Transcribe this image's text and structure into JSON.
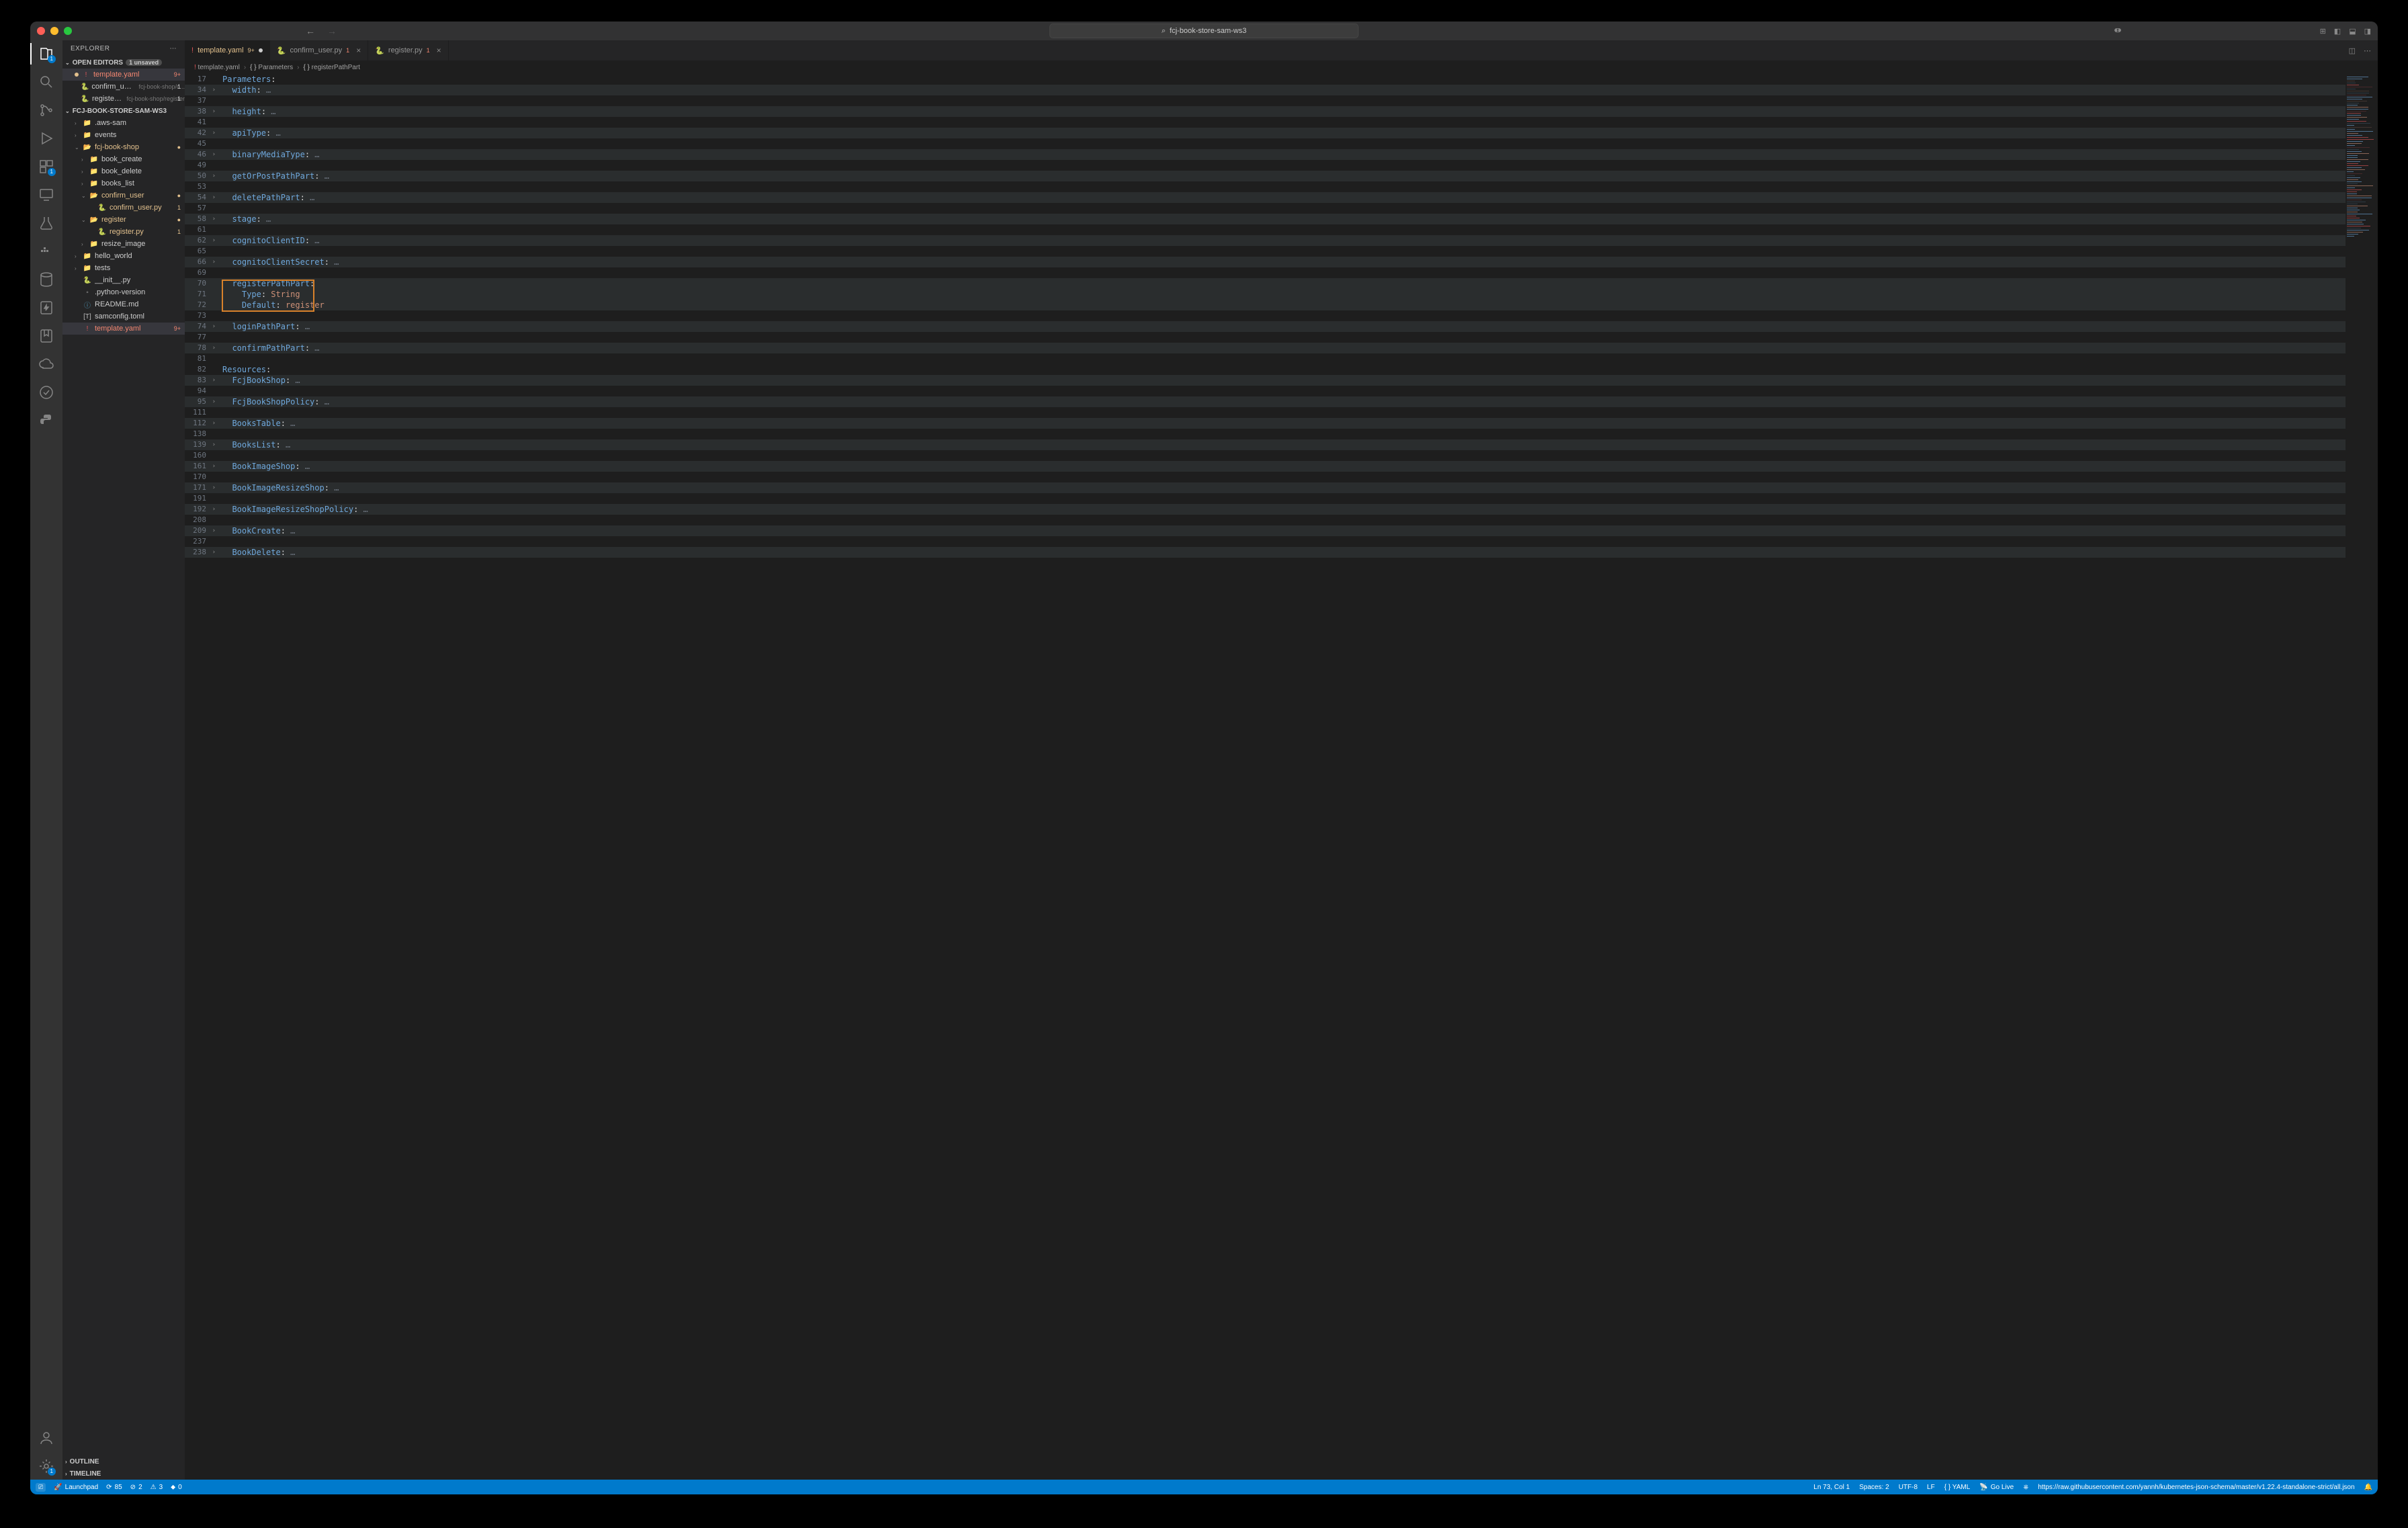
{
  "title": {
    "search_text": "fcj-book-store-sam-ws3"
  },
  "activity": {
    "badges": {
      "explorer": "1",
      "extensions": "1"
    }
  },
  "sidebar": {
    "title": "EXPLORER",
    "open_editors": {
      "label": "OPEN EDITORS",
      "unsaved_badge": "1 unsaved",
      "items": [
        {
          "name": "template.yaml",
          "icon": "yaml",
          "right": "9+",
          "state": "error",
          "active": true,
          "modified": true
        },
        {
          "name": "confirm_user.py",
          "desc": "fcj-book-shop/c...",
          "icon": "py",
          "right": "1"
        },
        {
          "name": "register.py",
          "desc": "fcj-book-shop/register",
          "icon": "py",
          "right": "1"
        }
      ]
    },
    "workspace": {
      "label": "FCJ-BOOK-STORE-SAM-WS3",
      "tree": [
        {
          "name": ".aws-sam",
          "icon": "folder-c",
          "depth": 0,
          "chev": "›"
        },
        {
          "name": "events",
          "icon": "folder-c",
          "depth": 0,
          "chev": "›"
        },
        {
          "name": "fcj-book-shop",
          "icon": "folder",
          "depth": 0,
          "chev": "⌄",
          "state": "modified",
          "right": "●"
        },
        {
          "name": "book_create",
          "icon": "folder-c",
          "depth": 1,
          "chev": "›"
        },
        {
          "name": "book_delete",
          "icon": "folder-c",
          "depth": 1,
          "chev": "›"
        },
        {
          "name": "books_list",
          "icon": "folder-c",
          "depth": 1,
          "chev": "›"
        },
        {
          "name": "confirm_user",
          "icon": "folder",
          "depth": 1,
          "chev": "⌄",
          "state": "modified",
          "right": "●"
        },
        {
          "name": "confirm_user.py",
          "icon": "py",
          "depth": 2,
          "right": "1",
          "state": "modified"
        },
        {
          "name": "register",
          "icon": "folder",
          "depth": 1,
          "chev": "⌄",
          "state": "modified",
          "right": "●"
        },
        {
          "name": "register.py",
          "icon": "py",
          "depth": 2,
          "right": "1",
          "state": "modified"
        },
        {
          "name": "resize_image",
          "icon": "folder-c",
          "depth": 1,
          "chev": "›"
        },
        {
          "name": "hello_world",
          "icon": "folder-c",
          "depth": 0,
          "chev": "›"
        },
        {
          "name": "tests",
          "icon": "folder-c",
          "depth": 0,
          "chev": "›"
        },
        {
          "name": "__init__.py",
          "icon": "py",
          "depth": 0
        },
        {
          "name": ".python-version",
          "icon": "generic",
          "depth": 0
        },
        {
          "name": "README.md",
          "icon": "md",
          "depth": 0
        },
        {
          "name": "samconfig.toml",
          "icon": "toml",
          "depth": 0
        },
        {
          "name": "template.yaml",
          "icon": "yaml",
          "depth": 0,
          "right": "9+",
          "state": "error",
          "active": true
        }
      ]
    },
    "outline": "OUTLINE",
    "timeline": "TIMELINE"
  },
  "tabs": [
    {
      "name": "template.yaml",
      "icon": "yaml",
      "badge": "9+",
      "modified": true,
      "active": true
    },
    {
      "name": "confirm_user.py",
      "icon": "py",
      "err": "1"
    },
    {
      "name": "register.py",
      "icon": "py",
      "err": "1"
    }
  ],
  "breadcrumb": [
    {
      "icon": "yaml",
      "label": "template.yaml"
    },
    {
      "icon": "brace",
      "label": "Parameters"
    },
    {
      "icon": "brace",
      "label": "registerPathPart"
    }
  ],
  "code_lines": [
    {
      "n": 17,
      "tokens": [
        [
          "key",
          "Parameters"
        ],
        [
          "punc",
          ":"
        ]
      ]
    },
    {
      "n": 34,
      "fold": true,
      "hl": true,
      "tokens": [
        [
          "ind",
          "  "
        ],
        [
          "key",
          "width"
        ],
        [
          "punc",
          ":"
        ],
        [
          "ell",
          " …"
        ]
      ]
    },
    {
      "n": 37
    },
    {
      "n": 38,
      "fold": true,
      "hl": true,
      "tokens": [
        [
          "ind",
          "  "
        ],
        [
          "key",
          "height"
        ],
        [
          "punc",
          ":"
        ],
        [
          "ell",
          " …"
        ]
      ]
    },
    {
      "n": 41
    },
    {
      "n": 42,
      "fold": true,
      "hl": true,
      "tokens": [
        [
          "ind",
          "  "
        ],
        [
          "key",
          "apiType"
        ],
        [
          "punc",
          ":"
        ],
        [
          "ell",
          " …"
        ]
      ]
    },
    {
      "n": 45
    },
    {
      "n": 46,
      "fold": true,
      "hl": true,
      "tokens": [
        [
          "ind",
          "  "
        ],
        [
          "key",
          "binaryMediaType"
        ],
        [
          "punc",
          ":"
        ],
        [
          "ell",
          " …"
        ]
      ]
    },
    {
      "n": 49
    },
    {
      "n": 50,
      "fold": true,
      "hl": true,
      "tokens": [
        [
          "ind",
          "  "
        ],
        [
          "key",
          "getOrPostPathPart"
        ],
        [
          "punc",
          ":"
        ],
        [
          "ell",
          " …"
        ]
      ]
    },
    {
      "n": 53
    },
    {
      "n": 54,
      "fold": true,
      "hl": true,
      "tokens": [
        [
          "ind",
          "  "
        ],
        [
          "key",
          "deletePathPart"
        ],
        [
          "punc",
          ":"
        ],
        [
          "ell",
          " …"
        ]
      ]
    },
    {
      "n": 57
    },
    {
      "n": 58,
      "fold": true,
      "hl": true,
      "tokens": [
        [
          "ind",
          "  "
        ],
        [
          "key",
          "stage"
        ],
        [
          "punc",
          ":"
        ],
        [
          "ell",
          " …"
        ]
      ]
    },
    {
      "n": 61
    },
    {
      "n": 62,
      "fold": true,
      "hl": true,
      "tokens": [
        [
          "ind",
          "  "
        ],
        [
          "key",
          "cognitoClientID"
        ],
        [
          "punc",
          ":"
        ],
        [
          "ell",
          " …"
        ]
      ]
    },
    {
      "n": 65
    },
    {
      "n": 66,
      "fold": true,
      "hl": true,
      "tokens": [
        [
          "ind",
          "  "
        ],
        [
          "key",
          "cognitoClientSecret"
        ],
        [
          "punc",
          ":"
        ],
        [
          "ell",
          " …"
        ]
      ]
    },
    {
      "n": 69
    },
    {
      "n": 70,
      "hl": true,
      "tokens": [
        [
          "ind",
          "  "
        ],
        [
          "key",
          "registerPathPart"
        ],
        [
          "punc",
          ":"
        ]
      ]
    },
    {
      "n": 71,
      "hl": true,
      "tokens": [
        [
          "ind",
          "    "
        ],
        [
          "key",
          "Type"
        ],
        [
          "punc",
          ": "
        ],
        [
          "str",
          "String"
        ]
      ]
    },
    {
      "n": 72,
      "hl": true,
      "tokens": [
        [
          "ind",
          "    "
        ],
        [
          "key",
          "Default"
        ],
        [
          "punc",
          ": "
        ],
        [
          "str",
          "register"
        ]
      ]
    },
    {
      "n": 73,
      "current": true
    },
    {
      "n": 74,
      "fold": true,
      "hl": true,
      "tokens": [
        [
          "ind",
          "  "
        ],
        [
          "key",
          "loginPathPart"
        ],
        [
          "punc",
          ":"
        ],
        [
          "ell",
          " …"
        ]
      ]
    },
    {
      "n": 77
    },
    {
      "n": 78,
      "fold": true,
      "hl": true,
      "tokens": [
        [
          "ind",
          "  "
        ],
        [
          "key",
          "confirmPathPart"
        ],
        [
          "punc",
          ":"
        ],
        [
          "ell",
          " …"
        ]
      ]
    },
    {
      "n": 81
    },
    {
      "n": 82,
      "tokens": [
        [
          "key",
          "Resources"
        ],
        [
          "punc",
          ":"
        ]
      ]
    },
    {
      "n": 83,
      "fold": true,
      "hl": true,
      "tokens": [
        [
          "ind",
          "  "
        ],
        [
          "key",
          "FcjBookShop"
        ],
        [
          "punc",
          ":"
        ],
        [
          "ell",
          " …"
        ]
      ]
    },
    {
      "n": 94
    },
    {
      "n": 95,
      "fold": true,
      "hl": true,
      "tokens": [
        [
          "ind",
          "  "
        ],
        [
          "key",
          "FcjBookShopPolicy"
        ],
        [
          "punc",
          ":"
        ],
        [
          "ell",
          " …"
        ]
      ]
    },
    {
      "n": 111
    },
    {
      "n": 112,
      "fold": true,
      "hl": true,
      "tokens": [
        [
          "ind",
          "  "
        ],
        [
          "key",
          "BooksTable"
        ],
        [
          "punc",
          ":"
        ],
        [
          "ell",
          " …"
        ]
      ]
    },
    {
      "n": 138
    },
    {
      "n": 139,
      "fold": true,
      "hl": true,
      "tokens": [
        [
          "ind",
          "  "
        ],
        [
          "key",
          "BooksList"
        ],
        [
          "punc",
          ":"
        ],
        [
          "ell",
          " …"
        ]
      ]
    },
    {
      "n": 160
    },
    {
      "n": 161,
      "fold": true,
      "hl": true,
      "tokens": [
        [
          "ind",
          "  "
        ],
        [
          "key",
          "BookImageShop"
        ],
        [
          "punc",
          ":"
        ],
        [
          "ell",
          " …"
        ]
      ]
    },
    {
      "n": 170
    },
    {
      "n": 171,
      "fold": true,
      "hl": true,
      "tokens": [
        [
          "ind",
          "  "
        ],
        [
          "key",
          "BookImageResizeShop"
        ],
        [
          "punc",
          ":"
        ],
        [
          "ell",
          " …"
        ]
      ]
    },
    {
      "n": 191
    },
    {
      "n": 192,
      "fold": true,
      "hl": true,
      "tokens": [
        [
          "ind",
          "  "
        ],
        [
          "key",
          "BookImageResizeShopPolicy"
        ],
        [
          "punc",
          ":"
        ],
        [
          "ell",
          " …"
        ]
      ]
    },
    {
      "n": 208
    },
    {
      "n": 209,
      "fold": true,
      "hl": true,
      "tokens": [
        [
          "ind",
          "  "
        ],
        [
          "key",
          "BookCreate"
        ],
        [
          "punc",
          ":"
        ],
        [
          "ell",
          " …"
        ]
      ]
    },
    {
      "n": 237
    },
    {
      "n": 238,
      "fold": true,
      "hl": true,
      "tokens": [
        [
          "ind",
          "  "
        ],
        [
          "key",
          "BookDelete"
        ],
        [
          "punc",
          ":"
        ],
        [
          "ell",
          " …"
        ]
      ]
    }
  ],
  "highlight_box": {
    "top_line": 19,
    "height_lines": 3
  },
  "statusbar": {
    "left": [
      {
        "icon": "remote",
        "text": ""
      },
      {
        "icon": "rocket",
        "text": "Launchpad"
      },
      {
        "icon": "sync",
        "text": "85"
      },
      {
        "icon": "warn",
        "text": "2"
      },
      {
        "icon": "err-circ",
        "text": "3"
      },
      {
        "icon": "flame",
        "text": "0"
      }
    ],
    "right": [
      {
        "text": "Ln 73, Col 1"
      },
      {
        "text": "Spaces: 2"
      },
      {
        "text": "UTF-8"
      },
      {
        "text": "LF"
      },
      {
        "text": "{ } YAML"
      },
      {
        "icon": "broadcast",
        "text": "Go Live"
      },
      {
        "icon": "k8s",
        "text": ""
      },
      {
        "text": "https://raw.githubusercontent.com/yannh/kubernetes-json-schema/master/v1.22.4-standalone-strict/all.json"
      },
      {
        "icon": "bell",
        "text": ""
      }
    ]
  }
}
